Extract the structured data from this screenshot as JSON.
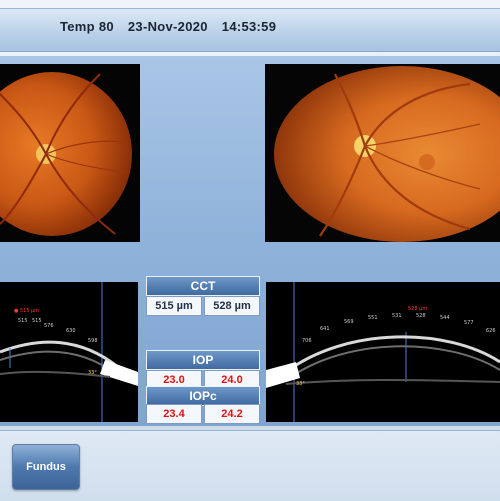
{
  "header": {
    "patient": "Temp 80",
    "date": "23-Nov-2020",
    "time": "14:53:59"
  },
  "measurements": {
    "cct": {
      "label": "CCT",
      "left": "515 µm",
      "right": "528 µm"
    },
    "iop": {
      "label": "IOP",
      "left": "23.0",
      "right": "24.0"
    },
    "iopc": {
      "label": "IOPc",
      "left": "23.4",
      "right": "24.2"
    }
  },
  "oct_left": {
    "values": [
      "515",
      "515",
      "576",
      "630",
      "598"
    ],
    "angle": "33°"
  },
  "oct_right": {
    "values": [
      "706",
      "641",
      "569",
      "551",
      "531",
      "528",
      "544",
      "577",
      "626"
    ],
    "angle": "33°"
  },
  "buttons": {
    "fundus": "Fundus"
  },
  "colors": {
    "accent": "#3f6aa0",
    "iop_red": "#e01010",
    "retina": "#d86a1e",
    "disc": "#f2c25a"
  },
  "icons": [
    "fundus-button-icon"
  ]
}
